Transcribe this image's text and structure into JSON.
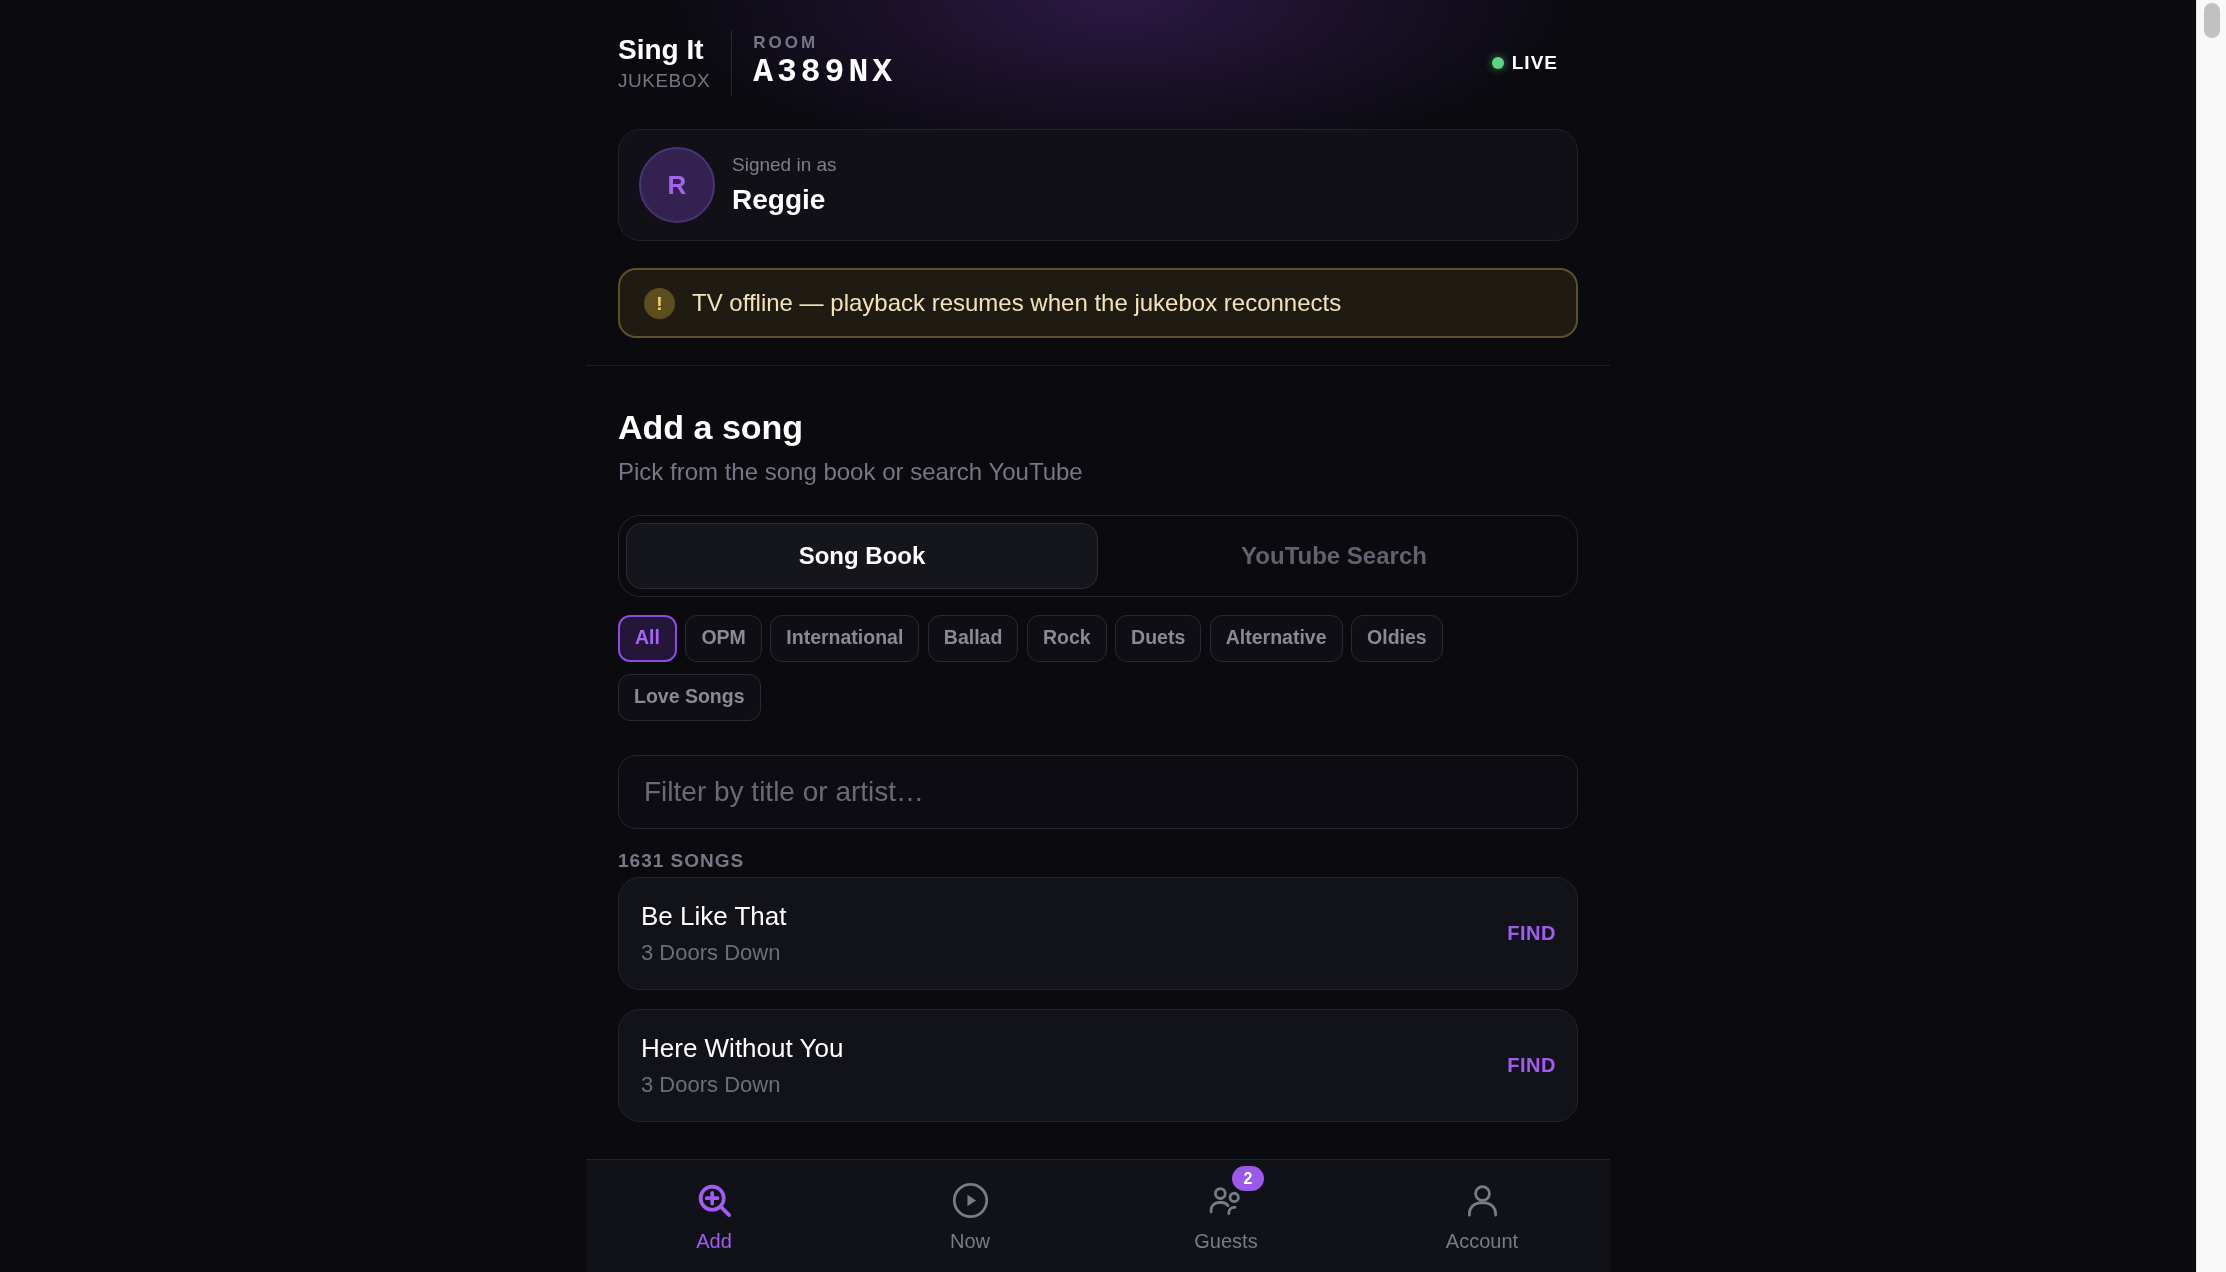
{
  "header": {
    "app_name": "Sing It",
    "app_subtitle": "JUKEBOX",
    "room_label": "ROOM",
    "room_code": "A389NX",
    "status": {
      "label": "LIVE",
      "live": true
    }
  },
  "user": {
    "initial": "R",
    "caption": "Signed in as",
    "name": "Reggie"
  },
  "alert": {
    "kind": "warning",
    "icon_text": "!",
    "message": "TV offline — playback resumes when the jukebox reconnects"
  },
  "section": {
    "title": "Add a song",
    "subtitle": "Pick from the song book or search YouTube"
  },
  "tabs": [
    {
      "label": "Song Book",
      "selected": true
    },
    {
      "label": "YouTube Search",
      "selected": false
    }
  ],
  "categories": [
    {
      "label": "All",
      "selected": true
    },
    {
      "label": "OPM",
      "selected": false
    },
    {
      "label": "International",
      "selected": false
    },
    {
      "label": "Ballad",
      "selected": false
    },
    {
      "label": "Rock",
      "selected": false
    },
    {
      "label": "Duets",
      "selected": false
    },
    {
      "label": "Alternative",
      "selected": false
    },
    {
      "label": "Oldies",
      "selected": false
    },
    {
      "label": "Love Songs",
      "selected": false
    }
  ],
  "filter": {
    "placeholder": "Filter by title or artist…"
  },
  "song_count": "1631 SONGS",
  "songs": [
    {
      "title": "Be Like That",
      "artist": "3 Doors Down",
      "action": "FIND"
    },
    {
      "title": "Here Without You",
      "artist": "3 Doors Down",
      "action": "FIND"
    }
  ],
  "nav": [
    {
      "label": "Add",
      "kind": "add",
      "selected": true
    },
    {
      "label": "Now",
      "kind": "now",
      "selected": false
    },
    {
      "label": "Guests",
      "kind": "guests",
      "selected": false,
      "badge": "2"
    },
    {
      "label": "Account",
      "kind": "account",
      "selected": false
    }
  ]
}
